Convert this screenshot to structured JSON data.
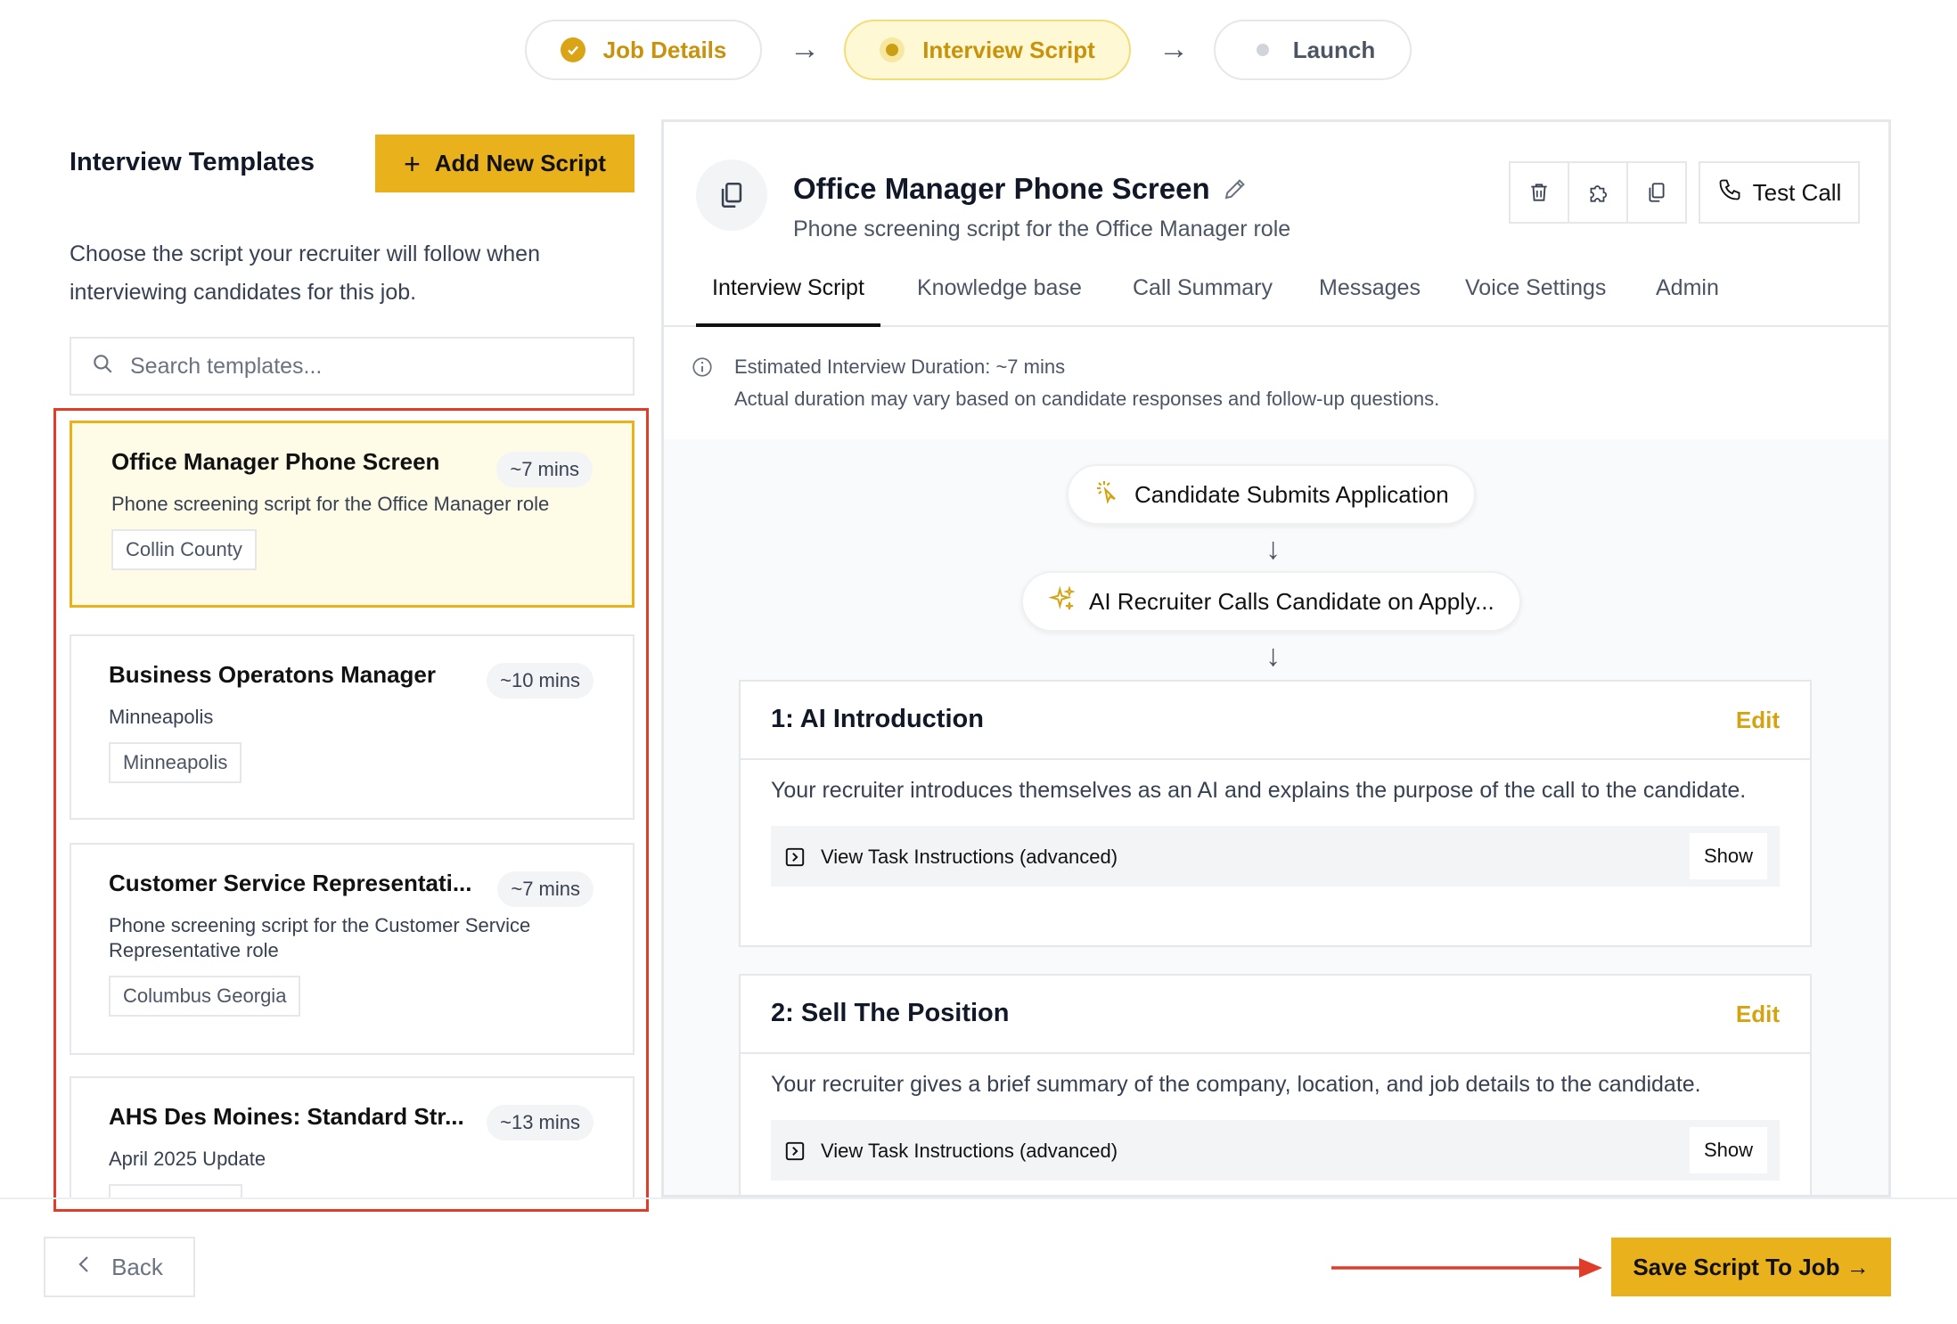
{
  "stepper": {
    "steps": [
      {
        "label": "Job Details",
        "state": "complete"
      },
      {
        "label": "Interview Script",
        "state": "active"
      },
      {
        "label": "Launch",
        "state": "pending"
      }
    ]
  },
  "left": {
    "title": "Interview Templates",
    "add_button": "Add New Script",
    "description": "Choose the script your recruiter will follow when interviewing candidates for this job.",
    "search_placeholder": "Search templates...",
    "templates": [
      {
        "name": "Office Manager Phone Screen",
        "duration": "~7 mins",
        "subtitle": "Phone screening script for the Office Manager role",
        "tag": "Collin County",
        "selected": true
      },
      {
        "name": "Business Operatons Manager",
        "duration": "~10 mins",
        "subtitle": "Minneapolis",
        "tag": "Minneapolis",
        "selected": false
      },
      {
        "name": "Customer Service Representati...",
        "duration": "~7 mins",
        "subtitle": "Phone screening script for the Customer Service Representative role",
        "tag": "Columbus Georgia",
        "selected": false
      },
      {
        "name": "AHS Des Moines: Standard Str...",
        "duration": "~13 mins",
        "subtitle": "April 2025 Update",
        "tag": "",
        "selected": false
      }
    ]
  },
  "right": {
    "title": "Office Manager Phone Screen",
    "subtitle": "Phone screening script for the Office Manager role",
    "test_call": "Test Call",
    "tabs": [
      "Interview Script",
      "Knowledge base",
      "Call Summary",
      "Messages",
      "Voice Settings",
      "Admin"
    ],
    "active_tab": "Interview Script",
    "estimate_line1": "Estimated Interview Duration: ~7 mins",
    "estimate_line2": "Actual duration may vary based on candidate responses and follow-up questions.",
    "flow": {
      "trigger": "Candidate Submits Application",
      "action": "AI Recruiter Calls Candidate on Apply..."
    },
    "steps": [
      {
        "title": "1: AI Introduction",
        "edit": "Edit",
        "description": "Your recruiter introduces themselves as an AI and explains the purpose of the call to the candidate.",
        "task_label": "View Task Instructions (advanced)",
        "show": "Show"
      },
      {
        "title": "2: Sell The Position",
        "edit": "Edit",
        "description": "Your recruiter gives a brief summary of the company, location, and job details to the candidate.",
        "task_label": "View Task Instructions (advanced)",
        "show": "Show"
      }
    ]
  },
  "footer": {
    "back": "Back",
    "save": "Save Script To Job →"
  },
  "colors": {
    "accent": "#e9b11b",
    "selected_bg": "#fefbe6",
    "annotation_red": "#e03c2a"
  }
}
